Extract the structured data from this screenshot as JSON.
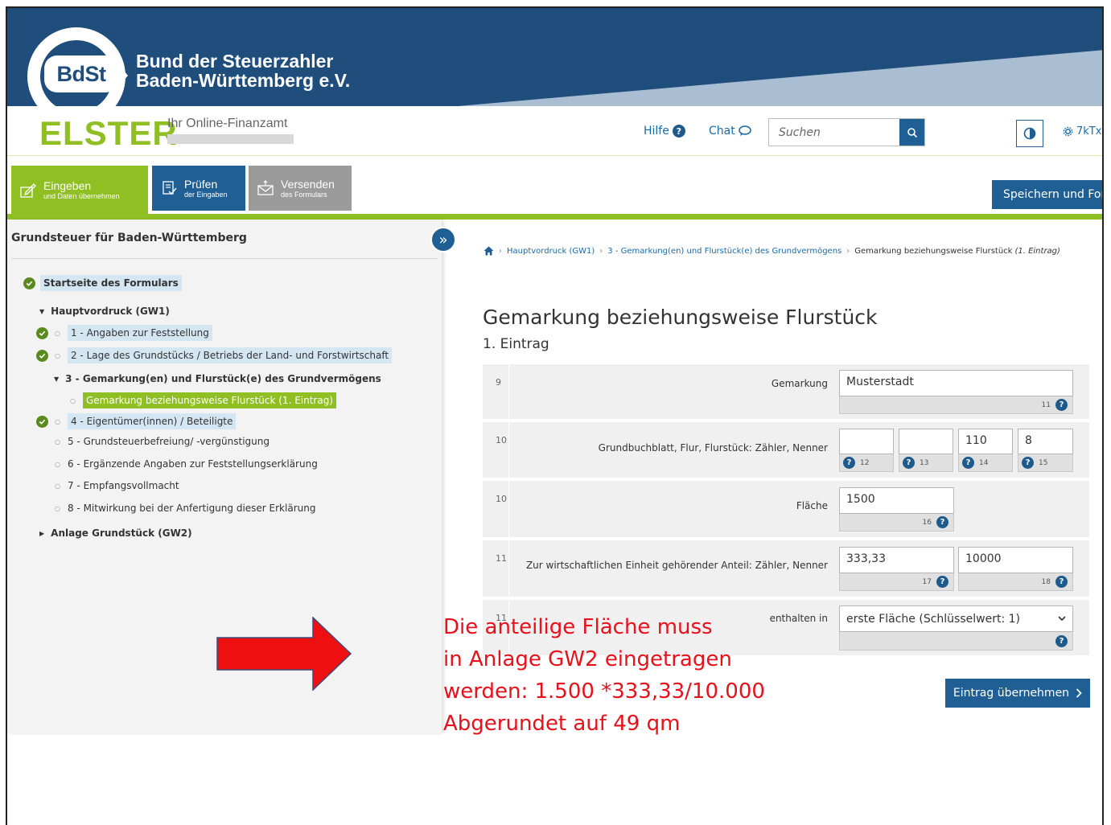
{
  "banner": {
    "logo_text": "BdSt",
    "org_line1": "Bund der Steuerzahler",
    "org_line2": "Baden-Württemberg e.V.",
    "colors": {
      "bg": "#1f4d7c",
      "light": "#a9bed3"
    }
  },
  "header": {
    "logo": "ELSTER",
    "tagline": "Ihr Online-Finanzamt",
    "help_label": "Hilfe",
    "chat_label": "Chat",
    "search_placeholder": "Suchen",
    "user_label": "7kTx",
    "icons": {
      "help": "question-circle-icon",
      "chat": "chat-bubble-icon",
      "search": "search-icon",
      "contrast": "contrast-icon",
      "user": "gear-icon"
    }
  },
  "steps": [
    {
      "title": "Eingeben",
      "sub": "und Daten übernehmen",
      "icon": "pencil-icon"
    },
    {
      "title": "Prüfen",
      "sub": "der Eingaben",
      "icon": "checklist-icon"
    },
    {
      "title": "Versenden",
      "sub": "des Formulars",
      "icon": "envelope-icon"
    }
  ],
  "save_button": "Speichern und For",
  "sidebar": {
    "title": "Grundsteuer für Baden-Württemberg",
    "start": "Startseite des Formulars",
    "hauptvordruck": "Hauptvordruck (GW1)",
    "items": [
      {
        "label": "1 - Angaben zur Feststellung"
      },
      {
        "label": "2 - Lage des Grundstücks / Betriebs der Land- und Forstwirtschaft"
      },
      {
        "label": "3 - Gemarkung(en) und Flurstück(e) des Grundvermögens"
      },
      {
        "label": "Gemarkung beziehungsweise Flurstück (1. Eintrag)"
      },
      {
        "label": "4 - Eigentümer(innen) / Beteiligte"
      },
      {
        "label": "5 - Grundsteuerbefreiung/ -vergünstigung"
      },
      {
        "label": "6 - Ergänzende Angaben zur Feststellungserklärung"
      },
      {
        "label": "7 - Empfangsvollmacht"
      },
      {
        "label": "8 - Mitwirkung bei der Anfertigung dieser Erklärung"
      }
    ],
    "anlage": "Anlage Grundstück (GW2)"
  },
  "breadcrumb": {
    "items": [
      "Hauptvordruck (GW1)",
      "3 - Gemarkung(en) und Flurstück(e) des Grundvermögens"
    ],
    "current": "Gemarkung beziehungsweise Flurstück",
    "current_suffix": "(1. Eintrag)"
  },
  "form": {
    "title": "Gemarkung beziehungsweise Flurstück",
    "subtitle": "1. Eintrag",
    "rows": [
      {
        "num": "9",
        "label": "Gemarkung",
        "value": "Musterstadt",
        "hint": "11"
      },
      {
        "num": "10",
        "label": "Grundbuchblatt,  Flur,  Flurstück: Zähler,  Nenner",
        "values": [
          "",
          "",
          "110",
          "8"
        ],
        "hints": [
          "12",
          "13",
          "14",
          "15"
        ]
      },
      {
        "num": "10",
        "label": "Fläche",
        "value": "1500",
        "hint": "16"
      },
      {
        "num": "11",
        "label": "Zur wirtschaftlichen Einheit gehörender Anteil: Zähler,  Nenner",
        "values": [
          "333,33",
          "10000"
        ],
        "hints": [
          "17",
          "18"
        ]
      },
      {
        "num": "11",
        "label": "enthalten in",
        "value": "erste Fläche (Schlüsselwert: 1)"
      }
    ],
    "apply_button": "Eintrag übernehmen"
  },
  "annotation": {
    "line1": "Die anteilige Fläche muss",
    "line2": "in Anlage GW2 eingetragen",
    "line3": "werden: 1.500 *333,33/10.000",
    "line4": "Abgerundet auf 49 qm",
    "color": "#e8101a"
  }
}
